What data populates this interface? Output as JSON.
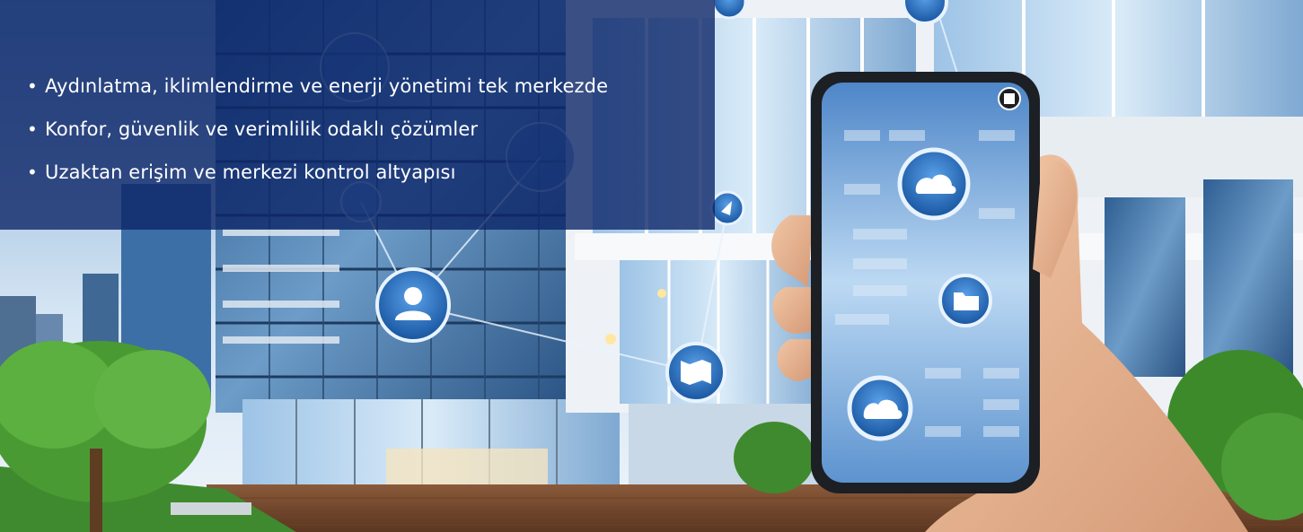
{
  "hero": {
    "features": [
      {
        "text": "Aydınlatma, iklimlendirme ve enerji yönetimi tek merkezde"
      },
      {
        "text": "Konfor, güvenlik ve verimlilik odaklı çözümler"
      },
      {
        "text": "Uzaktan erişim ve merkezi kontrol altyapısı"
      }
    ],
    "bullet": "•"
  },
  "colors": {
    "panel": "#0c2668",
    "accent_blue": "#1f6fd0",
    "sky": "#dbe9f5",
    "grass": "#3f8a2e"
  },
  "icons": [
    "user-icon",
    "cloud-icon",
    "folder-icon",
    "map-icon",
    "location-icon",
    "cloud-car-icon",
    "tag-icon"
  ]
}
